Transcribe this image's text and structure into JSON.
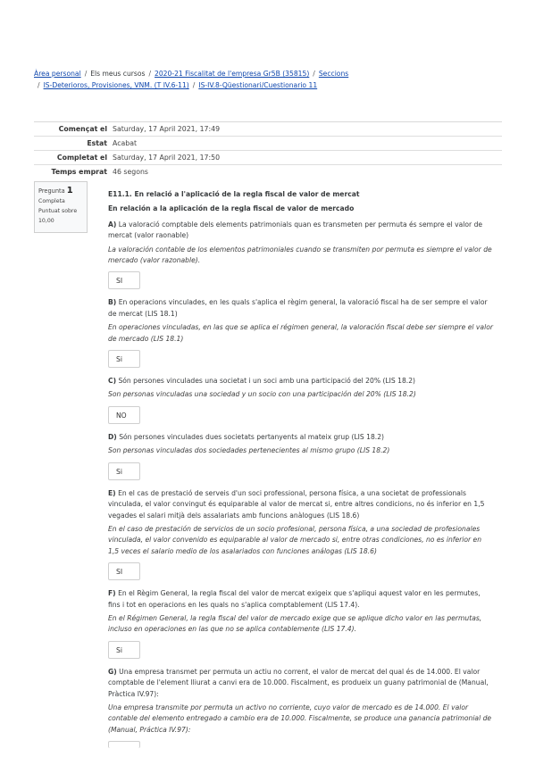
{
  "breadcrumb": {
    "items": [
      {
        "label": "Àrea personal",
        "link": true
      },
      {
        "label": "Els meus cursos",
        "link": false
      },
      {
        "label": "2020-21 Fiscalitat de l'empresa Gr5B (35815)",
        "link": true
      },
      {
        "label": "Seccions",
        "link": true
      },
      {
        "label": "IS-Deterioros, Provisiones, VNM. (T IV.6-11)",
        "link": true
      },
      {
        "label": "IS-IV.8-Qüestionari/Cuestionario 11",
        "link": true
      }
    ],
    "separator": "/"
  },
  "summary": {
    "rows": [
      {
        "label": "Començat el",
        "value": "Saturday, 17 April 2021, 17:49"
      },
      {
        "label": "Estat",
        "value": "Acabat"
      },
      {
        "label": "Completat el",
        "value": "Saturday, 17 April 2021, 17:50"
      },
      {
        "label": "Temps emprat",
        "value": "46 segons"
      }
    ]
  },
  "question_info": {
    "prefix": "Pregunta",
    "number": "1",
    "state": "Completa",
    "mark_line1": "Puntuat sobre",
    "mark_line2": "10,00"
  },
  "question": {
    "title": "E11.1. En relació a l'aplicació de la regla fiscal de valor de mercat",
    "subtitle": "En relación a la aplicación de la regla fiscal de valor de mercado",
    "items": [
      {
        "letter": "A)",
        "ca": "La valoració comptable dels elements patrimonials quan es transmeten per permuta és sempre el valor de mercat (valor raonable)",
        "es": "La valoración contable de los elementos patrimoniales cuando se transmiten por permuta es siempre el valor de mercado (valor razonable).",
        "answer": "SI"
      },
      {
        "letter": "B)",
        "ca": "En operacions vinculades, en les quals s'aplica el règim general, la valoració fiscal ha de ser sempre el valor de mercat (LIS 18.1)",
        "es": "En operaciones vinculadas, en las que se aplica el régimen general, la valoración fiscal debe ser siempre el valor de mercado (LIS 18.1)",
        "answer": "Si"
      },
      {
        "letter": "C)",
        "ca": "Són persones vinculades una societat i un soci amb una participació del 20% (LIS 18.2)",
        "es": "Son personas vinculadas una sociedad y un socio con una participación del 20% (LIS 18.2)",
        "answer": "NO"
      },
      {
        "letter": "D)",
        "ca": "Són persones vinculades dues societats pertanyents al mateix grup (LIS 18.2)",
        "es": "Son personas vinculadas dos sociedades pertenecientes al mismo grupo (LIS 18.2)",
        "answer": "Si"
      },
      {
        "letter": "E)",
        "ca": "En el cas de prestació de serveis d'un soci professional, persona física, a una societat de professionals vinculada, el valor convingut és equiparable al valor de mercat si, entre altres condicions, no és inferior en 1,5 vegades el salari mitjà dels assalariats amb funcions anàlogues (LIS 18.6)",
        "es": "En el caso de prestación de servicios de un socio profesional, persona física, a una sociedad de profesionales vinculada, el valor convenido es equiparable al valor de mercado si, entre otras condiciones, no es inferior en 1,5 veces el salario medio de los asalariados con funciones análogas (LIS 18.6)",
        "answer": "SI"
      },
      {
        "letter": "F)",
        "ca": "En el Règim General, la regla fiscal del valor de mercat exigeix que s'apliqui aquest valor en les permutes, fins i tot en operacions en les quals no s'aplica comptablement (LIS 17.4).",
        "es": "En el Régimen General, la regla fiscal del valor de mercado exige que se aplique dicho valor en las permutas, incluso en operaciones en las que no se aplica contablemente (LIS 17.4).",
        "answer": "Si"
      },
      {
        "letter": "G)",
        "ca": "Una empresa transmet per permuta un actiu no corrent, el valor de mercat del qual és de 14.000. El valor comptable de l'element lliurat a canvi era de 10.000. Fiscalment, es produeix un guany patrimonial de (Manual, Pràctica IV.97):",
        "es": "Una empresa transmite por permuta un activo no corriente, cuyo valor de mercado es de 14.000. El valor contable del elemento entregado a cambio era de 10.000. Fiscalmente, se produce una ganancia patrimonial de (Manual, Práctica IV.97):",
        "answer": ""
      }
    ]
  }
}
